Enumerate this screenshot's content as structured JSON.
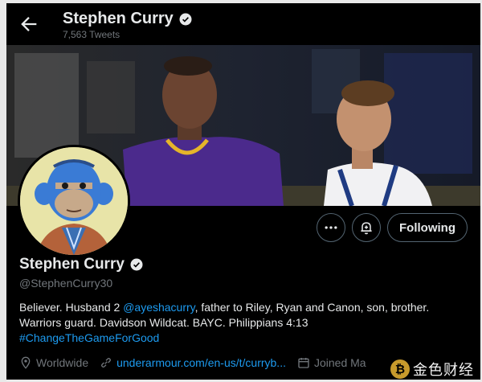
{
  "header": {
    "name": "Stephen Curry",
    "tweet_count": "7,563 Tweets"
  },
  "icons": {
    "back": "arrow-left-icon",
    "verified": "verified-badge-icon",
    "more": "more-dots-icon",
    "notify": "bell-plus-icon",
    "location": "location-pin-icon",
    "link": "link-icon",
    "calendar": "calendar-icon"
  },
  "actions": {
    "follow_label": "Following"
  },
  "profile": {
    "name": "Stephen Curry",
    "handle": "@StephenCurry30",
    "bio_part1": "Believer. Husband 2 ",
    "bio_mention": "@ayeshacurry",
    "bio_part2": ", father to Riley, Ryan and Canon, son, brother. Warriors guard. Davidson Wildcat. BAYC. Philippians 4:13",
    "bio_hashtag": "#ChangeTheGameForGood",
    "location": "Worldwide",
    "website": "underarmour.com/en-us/t/curryb...",
    "joined": "Joined Ma"
  },
  "watermark": {
    "text": "金色财经"
  },
  "colors": {
    "background": "#000000",
    "text": "#e7e9ea",
    "muted": "#71767b",
    "accent": "#1d9bf0",
    "border": "#536471"
  }
}
